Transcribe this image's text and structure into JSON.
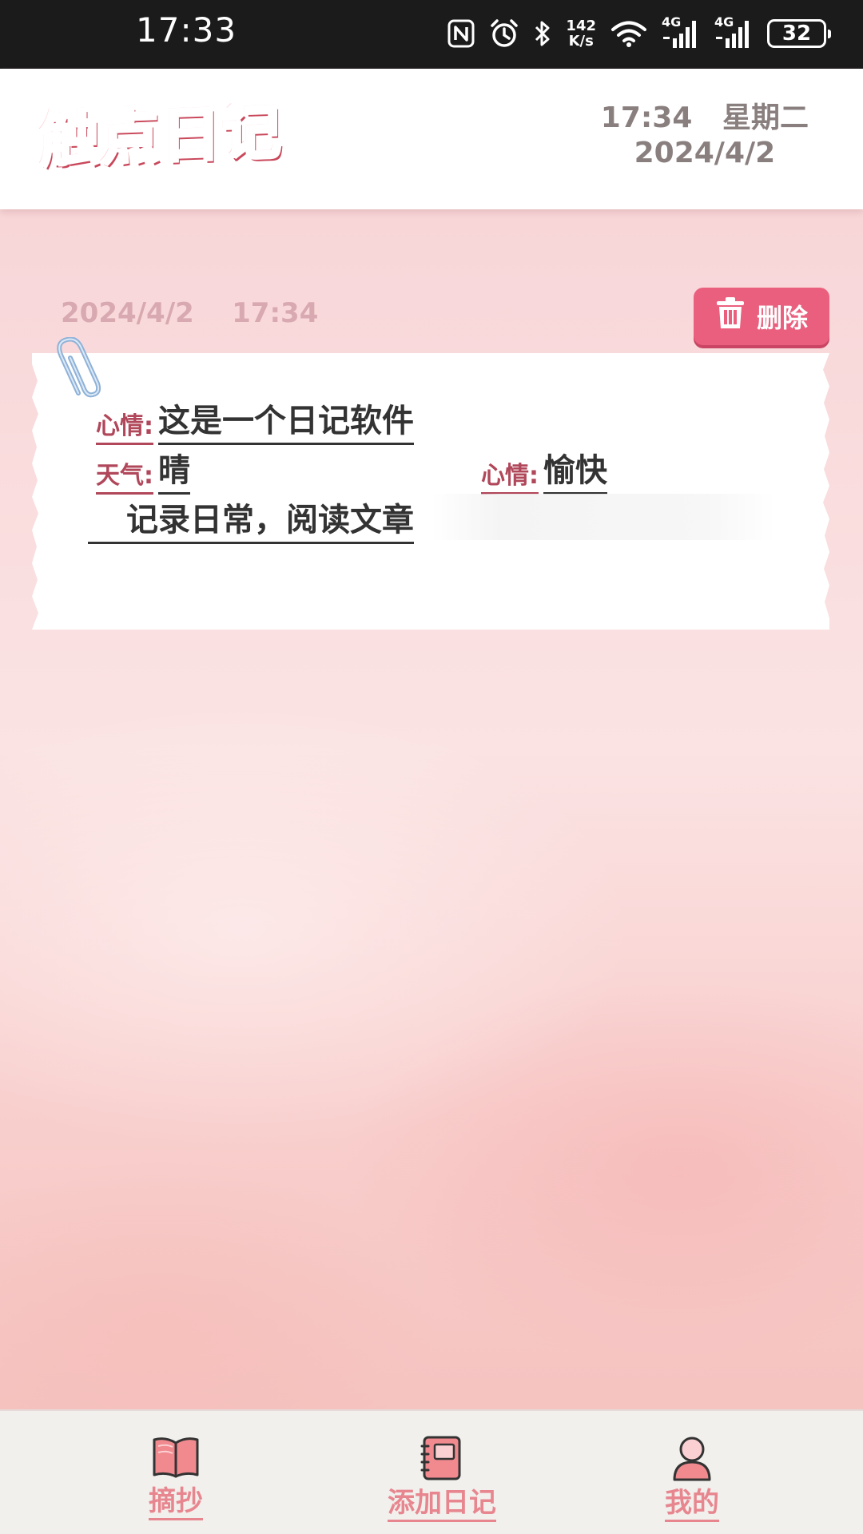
{
  "status_bar": {
    "time": "17:33",
    "net_speed_value": "142",
    "net_speed_unit": "K/s",
    "signal1_label": "4G",
    "signal2_label": "4G",
    "battery": "32",
    "icons": [
      "nfc-icon",
      "alarm-icon",
      "bluetooth-icon",
      "wifi-icon",
      "cell-signal-icon",
      "cell-signal-icon",
      "battery-icon"
    ]
  },
  "header": {
    "app_name": "触点日记",
    "time_weekday": "17:34   星期二",
    "date": "2024/4/2"
  },
  "entry": {
    "date_time": "2024/4/2    17:34",
    "delete_label": "删除",
    "title_label": "心情:",
    "title_value": "这是一个日记软件",
    "weather_label": "天气:",
    "weather_value": "晴",
    "mood_label": "心情:",
    "mood_value": "愉快",
    "content": "记录日常，阅读文章"
  },
  "bottom_nav": {
    "items": [
      {
        "label": "摘抄",
        "icon": "book-icon"
      },
      {
        "label": "添加日记",
        "icon": "notebook-icon"
      },
      {
        "label": "我的",
        "icon": "user-icon"
      }
    ]
  },
  "colors": {
    "accent": "#ea5f7d",
    "label": "#b0475a",
    "nav_text": "#e8868f",
    "logo": "#f0727e"
  }
}
